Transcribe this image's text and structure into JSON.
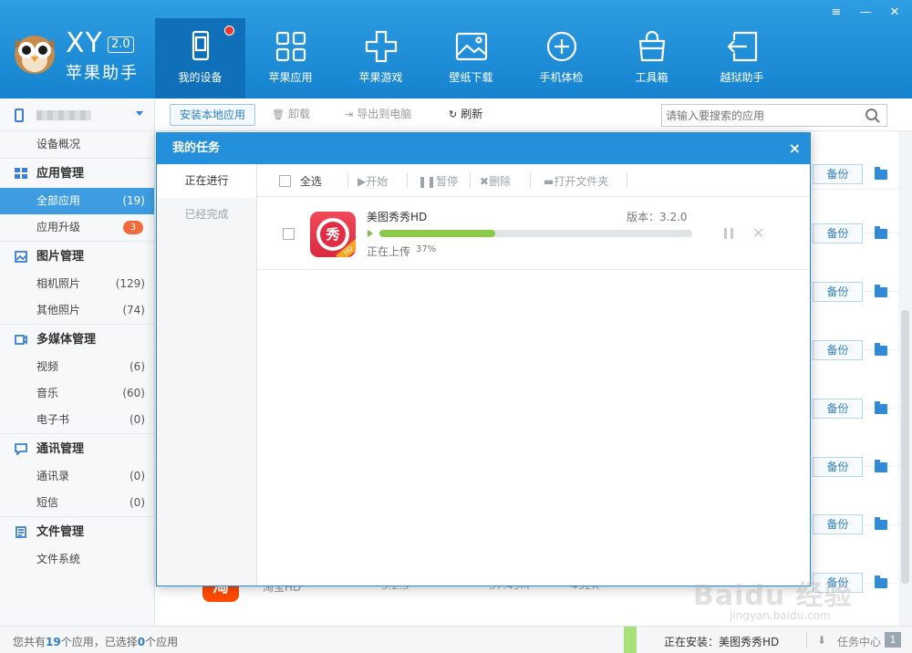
{
  "app": {
    "brand": "XY",
    "version": "2.0",
    "name": "苹果助手"
  },
  "nav": [
    {
      "label": "我的设备",
      "icon": "phone-icon",
      "active": true,
      "has_dot": true
    },
    {
      "label": "苹果应用",
      "icon": "apps-grid-icon"
    },
    {
      "label": "苹果游戏",
      "icon": "gamepad-icon"
    },
    {
      "label": "壁纸下载",
      "icon": "image-icon"
    },
    {
      "label": "手机体检",
      "icon": "plus-circle-icon"
    },
    {
      "label": "工具箱",
      "icon": "bag-icon"
    },
    {
      "label": "越狱助手",
      "icon": "exit-icon"
    }
  ],
  "window_buttons": [
    "≡",
    "—",
    "✕"
  ],
  "sidebar": {
    "device_overview": "设备概况",
    "sections": [
      {
        "title": "应用管理",
        "icon": "apps-icon",
        "items": [
          {
            "label": "全部应用",
            "count": "(19)",
            "active": true
          },
          {
            "label": "应用升级",
            "badge": "3"
          }
        ]
      },
      {
        "title": "图片管理",
        "icon": "picture-icon",
        "items": [
          {
            "label": "相机照片",
            "count": "(129)"
          },
          {
            "label": "其他照片",
            "count": "(74)"
          }
        ]
      },
      {
        "title": "多媒体管理",
        "icon": "media-icon",
        "items": [
          {
            "label": "视频",
            "count": "(6)"
          },
          {
            "label": "音乐",
            "count": "(60)"
          },
          {
            "label": "电子书",
            "count": "(0)"
          }
        ]
      },
      {
        "title": "通讯管理",
        "icon": "chat-icon",
        "items": [
          {
            "label": "通讯录",
            "count": "(0)"
          },
          {
            "label": "短信",
            "count": "(0)"
          }
        ]
      },
      {
        "title": "文件管理",
        "icon": "file-icon",
        "items": [
          {
            "label": "文件系统"
          }
        ]
      }
    ]
  },
  "toolbar": {
    "install_local": "安装本地应用",
    "uninstall": "卸载",
    "export": "导出到电脑",
    "refresh": "刷新",
    "search_placeholder": "请输入要搜索的应用"
  },
  "list": {
    "backup_label": "备份",
    "partial_row": {
      "name": "淘宝HD",
      "version": "3.2.3",
      "size": "37.49M",
      "doc": "452K",
      "icon_text": "淘"
    }
  },
  "modal": {
    "title": "我的任务",
    "close": "×",
    "tabs": [
      "正在进行",
      "已经完成"
    ],
    "toolbar": {
      "select_all": "全选",
      "start": "开始",
      "pause": "暂停",
      "delete": "删除",
      "open_folder": "打开文件夹"
    },
    "task": {
      "name": "美图秀秀HD",
      "version": "版本：3.2.0",
      "status": "正在上传",
      "percent_text": "37%",
      "progress": 0.37,
      "icon_text": "秀"
    }
  },
  "statusbar": {
    "prefix": "您共有",
    "total": "19",
    "mid": "个应用，已选择",
    "selected": "0",
    "suffix": "个应用",
    "installing": "正在安装：美图秀秀HD",
    "task_center": "任务中心",
    "task_count": "1"
  },
  "watermark": {
    "text": "Baidu 经验",
    "url": "jingyan.baidu.com"
  },
  "colors": {
    "header": "#1f8fd8",
    "accent": "#2490dc",
    "progress": "#8cc94a",
    "badge": "#f06a3c"
  }
}
